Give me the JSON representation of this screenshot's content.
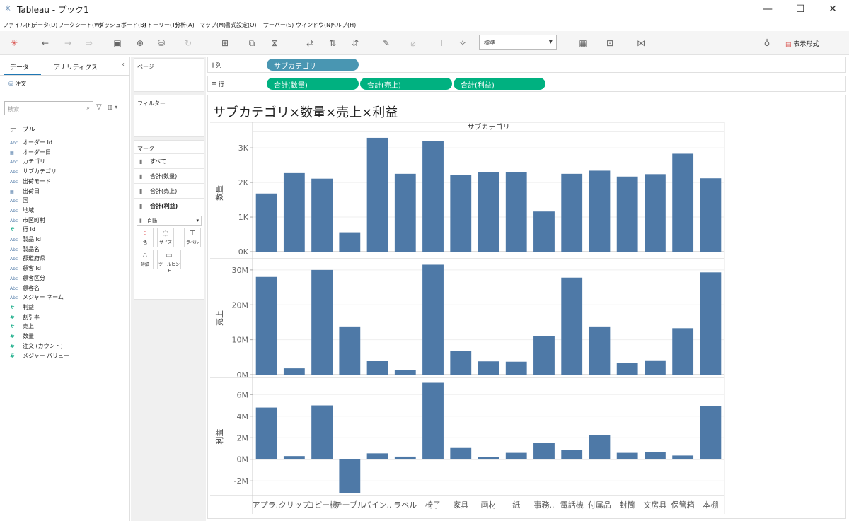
{
  "app": {
    "title": "Tableau - ブック1",
    "window_buttons": {
      "minimize": "—",
      "maximize": "☐",
      "close": "✕"
    }
  },
  "menu": [
    "ファイル(F)",
    "データ(D)",
    "ワークシート(W)",
    "ダッシュボード(B)",
    "ストーリー(T)",
    "分析(A)",
    "マップ(M)",
    "書式設定(O)",
    "サーバー(S)",
    "ウィンドウ(N)",
    "ヘルプ(H)"
  ],
  "toolbar": {
    "fit_value": "標準",
    "show_me_label": "表示形式",
    "icons": [
      "tableau-logo-icon",
      "undo-icon",
      "redo-icon",
      "forward-icon",
      "save-icon",
      "new-datasource-icon",
      "datasource-icon",
      "refresh-icon",
      "new-worksheet-icon",
      "duplicate-icon",
      "clear-icon",
      "swap-icon",
      "sort-asc-icon",
      "sort-desc-icon",
      "highlight-icon",
      "group-icon",
      "label-icon",
      "pin-icon",
      "show-cards-icon",
      "presentation-icon",
      "share-icon",
      "format-painter-icon"
    ]
  },
  "data_pane": {
    "tabs": [
      "データ",
      "アナリティクス"
    ],
    "datasource": "注文",
    "search_placeholder": "検索",
    "tables_label": "テーブル",
    "dimensions": [
      {
        "type": "Abc",
        "name": "オーダー Id"
      },
      {
        "type": "date",
        "name": "オーダー日"
      },
      {
        "type": "Abc",
        "name": "カテゴリ"
      },
      {
        "type": "Abc",
        "name": "サブカテゴリ"
      },
      {
        "type": "Abc",
        "name": "出荷モード"
      },
      {
        "type": "date",
        "name": "出荷日"
      },
      {
        "type": "Abc",
        "name": "国"
      },
      {
        "type": "Abc",
        "name": "地域"
      },
      {
        "type": "Abc",
        "name": "市区町村"
      },
      {
        "type": "#",
        "name": "行 Id"
      },
      {
        "type": "Abc",
        "name": "製品 Id"
      },
      {
        "type": "Abc",
        "name": "製品名"
      },
      {
        "type": "Abc",
        "name": "都道府県"
      },
      {
        "type": "Abc",
        "name": "顧客 Id"
      },
      {
        "type": "Abc",
        "name": "顧客区分"
      },
      {
        "type": "Abc",
        "name": "顧客名"
      },
      {
        "type": "Abc",
        "name": "メジャー ネーム"
      }
    ],
    "measures": [
      {
        "type": "#",
        "name": "利益"
      },
      {
        "type": "#",
        "name": "割引率"
      },
      {
        "type": "#",
        "name": "売上"
      },
      {
        "type": "#",
        "name": "数量"
      },
      {
        "type": "#",
        "name": "注文 (カウント)"
      },
      {
        "type": "#",
        "name": "メジャー バリュー"
      }
    ]
  },
  "cards": {
    "pages": "ページ",
    "filters": "フィルター",
    "marks": "マーク",
    "mark_tabs": [
      "すべて",
      "合計(数量)",
      "合計(売上)",
      "合計(利益)"
    ],
    "mark_type": "自動",
    "mark_buttons": [
      "色",
      "サイズ",
      "ラベル",
      "詳細",
      "ツールヒント"
    ]
  },
  "shelves": {
    "columns_label": "列",
    "rows_label": "行",
    "columns_pills": [
      "サブカテゴリ"
    ],
    "rows_pills": [
      "合計(数量)",
      "合計(売上)",
      "合計(利益)"
    ]
  },
  "sheet": {
    "title": "サブカテゴリ×数量×売上×利益"
  },
  "chart_data": {
    "type": "bar",
    "column_header": "サブカテゴリ",
    "categories": [
      "アプラ..",
      "クリップ",
      "コピー機",
      "テーブル",
      "バイン..",
      "ラベル",
      "椅子",
      "家具",
      "画材",
      "紙",
      "事務..",
      "電話機",
      "付属品",
      "封筒",
      "文房具",
      "保管箱",
      "本棚"
    ],
    "bar_color": "#4e79a7",
    "panes": [
      {
        "ylabel": "数量",
        "ylim": [
          0,
          3350
        ],
        "ticks": [
          0,
          1000,
          2000,
          3000
        ],
        "tick_labels": [
          "0K",
          "1K",
          "2K",
          "3K"
        ],
        "values": [
          1680,
          2270,
          2110,
          560,
          3290,
          2250,
          3200,
          2220,
          2300,
          2290,
          1160,
          2250,
          2340,
          2170,
          2240,
          2830,
          2120
        ]
      },
      {
        "ylabel": "売上",
        "ylim": [
          0,
          32000000
        ],
        "ticks": [
          0,
          10000000,
          20000000,
          30000000
        ],
        "tick_labels": [
          "0M",
          "10M",
          "20M",
          "30M"
        ],
        "values": [
          28000000,
          1800000,
          30000000,
          13800000,
          4000000,
          1300000,
          31500000,
          6800000,
          3800000,
          3700000,
          11000000,
          27800000,
          13800000,
          3400000,
          4100000,
          13300000,
          29300000
        ]
      },
      {
        "ylabel": "利益",
        "ylim": [
          -3100000,
          7200000
        ],
        "ticks": [
          -2000000,
          0,
          2000000,
          4000000,
          6000000
        ],
        "tick_labels": [
          "-2M",
          "0M",
          "2M",
          "4M",
          "6M"
        ],
        "values": [
          4800000,
          300000,
          5000000,
          -3100000,
          550000,
          250000,
          7100000,
          1050000,
          200000,
          600000,
          1500000,
          900000,
          2250000,
          600000,
          650000,
          350000,
          4950000
        ]
      }
    ]
  }
}
